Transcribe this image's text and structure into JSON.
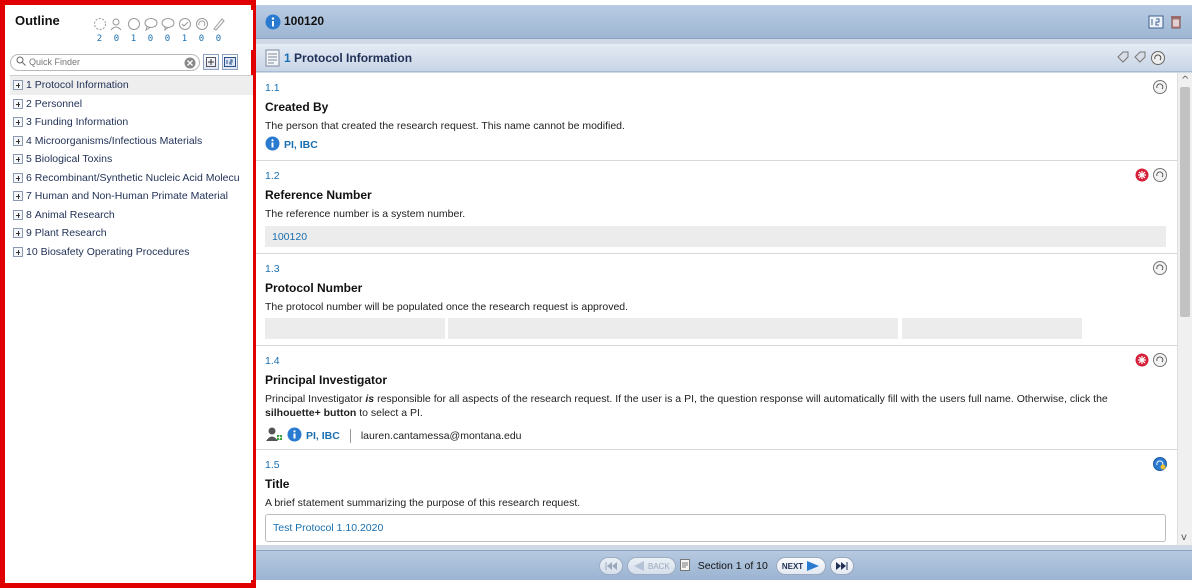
{
  "outline": {
    "title": "Outline",
    "status_icons": [
      "progress-icon",
      "person-check-icon",
      "circle-icon",
      "speech-icon",
      "comment-icon",
      "comment-check-icon",
      "comment-refresh-icon",
      "pen-icon"
    ],
    "status_counts": [
      "2",
      "0",
      "1",
      "0",
      "0",
      "1",
      "0",
      "0"
    ],
    "finder_placeholder": "Quick Finder",
    "items": [
      {
        "num": "1",
        "label": "Protocol Information"
      },
      {
        "num": "2",
        "label": "Personnel"
      },
      {
        "num": "3",
        "label": "Funding Information"
      },
      {
        "num": "4",
        "label": "Microorganisms/Infectious Materials"
      },
      {
        "num": "5",
        "label": "Biological Toxins"
      },
      {
        "num": "6",
        "label": "Recombinant/Synthetic Nucleic Acid Molecu"
      },
      {
        "num": "7",
        "label": "Human and Non-Human Primate Material"
      },
      {
        "num": "8",
        "label": "Animal Research"
      },
      {
        "num": "9",
        "label": "Plant Research"
      },
      {
        "num": "10",
        "label": "Biosafety Operating Procedures"
      }
    ]
  },
  "header": {
    "record_id": "100120"
  },
  "section": {
    "num": "1",
    "title": "Protocol Information"
  },
  "questions": {
    "q1": {
      "num": "1.1",
      "title": "Created By",
      "desc": "The person that created the research request. This name cannot be modified.",
      "answer": "PI, IBC"
    },
    "q2": {
      "num": "1.2",
      "title": "Reference Number",
      "desc": "The reference number is a system number.",
      "answer": "100120"
    },
    "q3": {
      "num": "1.3",
      "title": "Protocol Number",
      "desc": "The protocol number will be populated once the research request is approved."
    },
    "q4": {
      "num": "1.4",
      "title": "Principal Investigator",
      "desc_part1": "Principal Investigator ",
      "desc_is": "is",
      "desc_part2": " responsible for all aspects of the research request. If the user is a PI, the question response will automatically fill with the users full name. Otherwise, click the ",
      "desc_bold": "silhouette+ button",
      "desc_part3": " to select a PI.",
      "answer_name": "PI, IBC",
      "answer_email": "lauren.cantamessa@montana.edu"
    },
    "q5": {
      "num": "1.5",
      "title": "Title",
      "desc": "A brief statement summarizing the purpose of this research request.",
      "answer": "Test Protocol 1.10.2020"
    }
  },
  "navigation": {
    "back": "BACK",
    "section_label": "Section 1 of 10",
    "next": "NEXT"
  }
}
